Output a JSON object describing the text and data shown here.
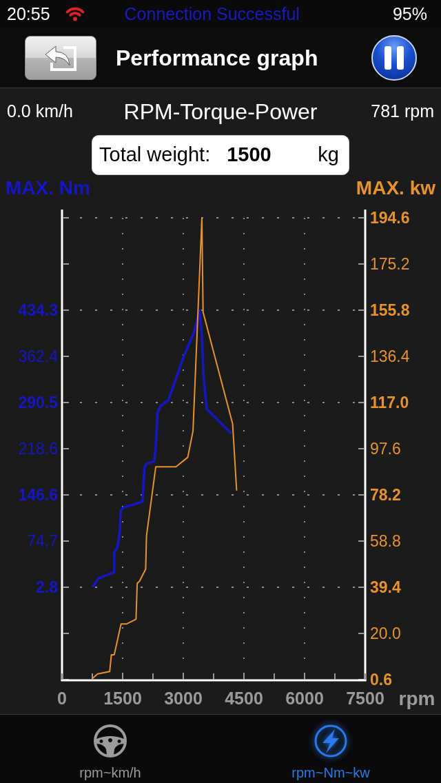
{
  "status_bar": {
    "time": "20:55",
    "message": "Connection Successful",
    "battery": "95%"
  },
  "header": {
    "title": "Performance graph"
  },
  "info": {
    "speed": "0.0 km/h",
    "title": "RPM-Torque-Power",
    "rpm": "781 rpm"
  },
  "weight": {
    "label": "Total weight:",
    "value": "1500",
    "unit": "kg"
  },
  "chart": {
    "chart_data": {
      "type": "line",
      "xlabel": "rpm",
      "xlim": [
        0,
        7500
      ],
      "xticks": [
        0,
        1500,
        3000,
        4500,
        6000,
        7500
      ],
      "ylim": [
        -141.0,
        578.1
      ],
      "yticks": [
        {
          "value": 434.3,
          "label": "434.3"
        },
        {
          "value": 362.4,
          "label": "362.4"
        },
        {
          "value": 290.5,
          "label": "290.5"
        },
        {
          "value": 218.6,
          "label": "218.6"
        },
        {
          "value": 146.6,
          "label": "146.6"
        },
        {
          "value": 74.7,
          "label": "74.7"
        },
        {
          "value": 2.8,
          "label": "2.8"
        }
      ],
      "y2lim": [
        0.6,
        194.6
      ],
      "y2ticks": [
        {
          "value": 194.6,
          "label": "194.6"
        },
        {
          "value": 175.2,
          "label": "175.2"
        },
        {
          "value": 155.8,
          "label": "155.8"
        },
        {
          "value": 136.4,
          "label": "136.4"
        },
        {
          "value": 117.0,
          "label": "117.0"
        },
        {
          "value": 97.6,
          "label": "97.6"
        },
        {
          "value": 78.2,
          "label": "78.2"
        },
        {
          "value": 58.8,
          "label": "58.8"
        },
        {
          "value": 39.4,
          "label": "39.4"
        },
        {
          "value": 20.0,
          "label": "20.0"
        },
        {
          "value": 0.6,
          "label": "0.6"
        }
      ],
      "grid": true,
      "series": [
        {
          "name": "MAX. Nm",
          "color": "#1616c4",
          "axis": "y",
          "x": [
            750,
            910,
            1290,
            1290,
            1370,
            1430,
            1450,
            1520,
            1990,
            2040,
            2090,
            2280,
            2320,
            2360,
            2440,
            2630,
            3010,
            3270,
            3400,
            3460,
            3500,
            3580,
            3730,
            4190
          ],
          "values": [
            3,
            17,
            26,
            57,
            65,
            89,
            122,
            127,
            136,
            189,
            195,
            199,
            223,
            275,
            285,
            294,
            362,
            400,
            434,
            395,
            333,
            280,
            271,
            242
          ]
        },
        {
          "name": "MAX. kw",
          "color": "#e8922e",
          "axis": "y2",
          "x": [
            750,
            880,
            1180,
            1220,
            1290,
            1460,
            1600,
            1830,
            1860,
            1920,
            2070,
            2090,
            2320,
            2820,
            3110,
            3240,
            3460,
            3490,
            4220,
            4320
          ],
          "values": [
            1,
            3,
            4,
            11,
            11,
            24,
            24,
            26,
            41,
            42,
            47,
            61,
            90,
            90,
            94,
            105,
            194.6,
            155,
            108,
            80
          ]
        }
      ]
    }
  },
  "tabs": [
    {
      "label": "rpm~km/h",
      "selected": false
    },
    {
      "label": "rpm~Nm~kw",
      "selected": true
    }
  ]
}
